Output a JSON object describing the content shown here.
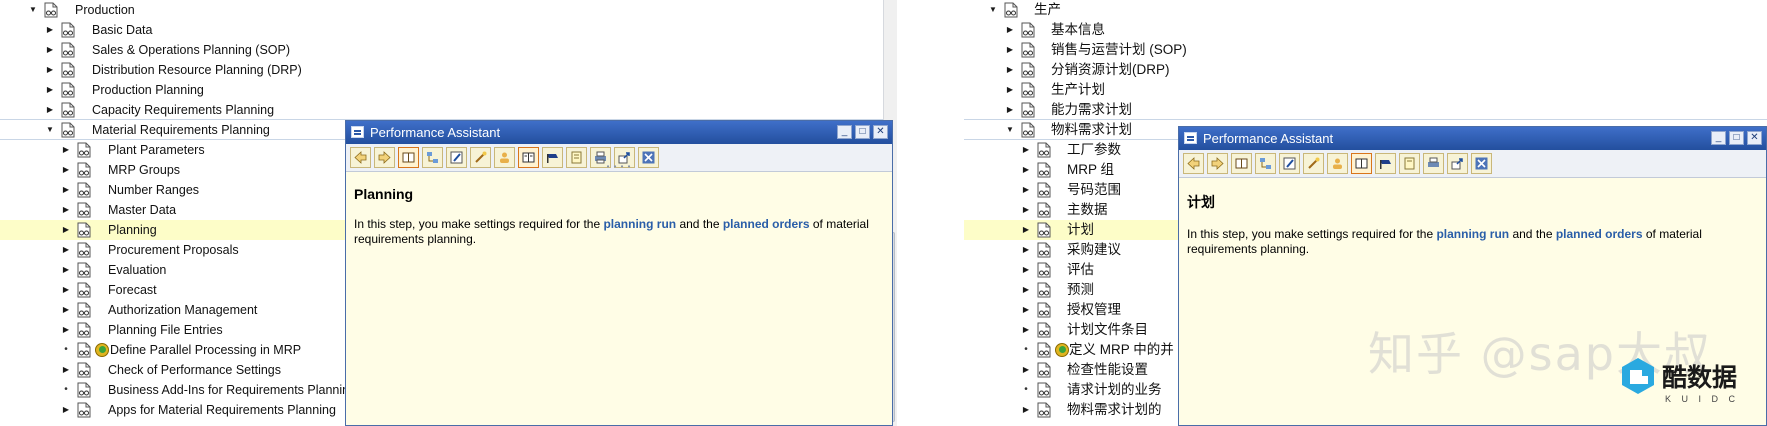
{
  "left_tree": {
    "items": [
      {
        "label": "Production",
        "arrow": "down",
        "level": 0
      },
      {
        "label": "Basic Data",
        "arrow": "right",
        "level": 1
      },
      {
        "label": "Sales & Operations Planning (SOP)",
        "arrow": "right",
        "level": 1
      },
      {
        "label": "Distribution Resource Planning (DRP)",
        "arrow": "right",
        "level": 1
      },
      {
        "label": "Production Planning",
        "arrow": "right",
        "level": 1
      },
      {
        "label": "Capacity Requirements Planning",
        "arrow": "right",
        "level": 1
      },
      {
        "label": "Material Requirements Planning",
        "arrow": "down",
        "level": 1
      },
      {
        "label": "Plant Parameters",
        "arrow": "right",
        "level": 2
      },
      {
        "label": "MRP Groups",
        "arrow": "right",
        "level": 2
      },
      {
        "label": "Number Ranges",
        "arrow": "right",
        "level": 2
      },
      {
        "label": "Master Data",
        "arrow": "right",
        "level": 2
      },
      {
        "label": "Planning",
        "arrow": "right",
        "level": 2
      },
      {
        "label": "Procurement Proposals",
        "arrow": "right",
        "level": 2
      },
      {
        "label": "Evaluation",
        "arrow": "right",
        "level": 2
      },
      {
        "label": "Forecast",
        "arrow": "right",
        "level": 2
      },
      {
        "label": "Authorization Management",
        "arrow": "right",
        "level": 2
      },
      {
        "label": "Planning File Entries",
        "arrow": "right",
        "level": 2
      },
      {
        "label": "Define Parallel Processing in MRP",
        "arrow": "dot",
        "level": 2
      },
      {
        "label": "Check of Performance Settings",
        "arrow": "right",
        "level": 2
      },
      {
        "label": "Business Add-Ins for Requirements Planning",
        "arrow": "dot",
        "level": 2
      },
      {
        "label": "Apps for Material Requirements Planning",
        "arrow": "right",
        "level": 2
      }
    ]
  },
  "right_tree": {
    "items": [
      {
        "label": "生产",
        "arrow": "down",
        "level": 0
      },
      {
        "label": "基本信息",
        "arrow": "right",
        "level": 1
      },
      {
        "label": "销售与运营计划 (SOP)",
        "arrow": "right",
        "level": 1
      },
      {
        "label": "分销资源计划(DRP)",
        "arrow": "right",
        "level": 1
      },
      {
        "label": "生产计划",
        "arrow": "right",
        "level": 1
      },
      {
        "label": "能力需求计划",
        "arrow": "right",
        "level": 1
      },
      {
        "label": "物料需求计划",
        "arrow": "down",
        "level": 1
      },
      {
        "label": "工厂参数",
        "arrow": "right",
        "level": 2
      },
      {
        "label": "MRP 组",
        "arrow": "right",
        "level": 2
      },
      {
        "label": "号码范围",
        "arrow": "right",
        "level": 2
      },
      {
        "label": "主数据",
        "arrow": "right",
        "level": 2
      },
      {
        "label": "计划",
        "arrow": "right",
        "level": 2
      },
      {
        "label": "采购建议",
        "arrow": "right",
        "level": 2
      },
      {
        "label": "评估",
        "arrow": "right",
        "level": 2
      },
      {
        "label": "预测",
        "arrow": "right",
        "level": 2
      },
      {
        "label": "授权管理",
        "arrow": "right",
        "level": 2
      },
      {
        "label": "计划文件条目",
        "arrow": "right",
        "level": 2
      },
      {
        "label": "定义 MRP 中的并",
        "arrow": "dot",
        "level": 2
      },
      {
        "label": "检查性能设置",
        "arrow": "right",
        "level": 2
      },
      {
        "label": "请求计划的业务",
        "arrow": "dot",
        "level": 2
      },
      {
        "label": "物料需求计划的",
        "arrow": "right",
        "level": 2
      }
    ]
  },
  "pa_left": {
    "title": "Performance Assistant",
    "heading": "Planning",
    "text_1": "In this step, you make settings required for the ",
    "link_1": "planning run",
    "text_2": " and the ",
    "link_2": "planned orders",
    "text_3": " of material requirements planning."
  },
  "pa_right": {
    "title": "Performance Assistant",
    "heading": "计划",
    "text_1": "In this step, you make settings required for the ",
    "link_1": "planning run",
    "text_2": " and the ",
    "link_2": "planned orders",
    "text_3": " of material requirements planning."
  },
  "watermark": {
    "zhihu": "知乎 @sap大叔",
    "brand": "酷数据",
    "brand_sub": "K U I D C"
  },
  "colors": {
    "selected_row": "#fdfdc8",
    "title_bar": "#2f5fb5",
    "link": "#2a5ea8",
    "pa_background": "#fffde6"
  }
}
